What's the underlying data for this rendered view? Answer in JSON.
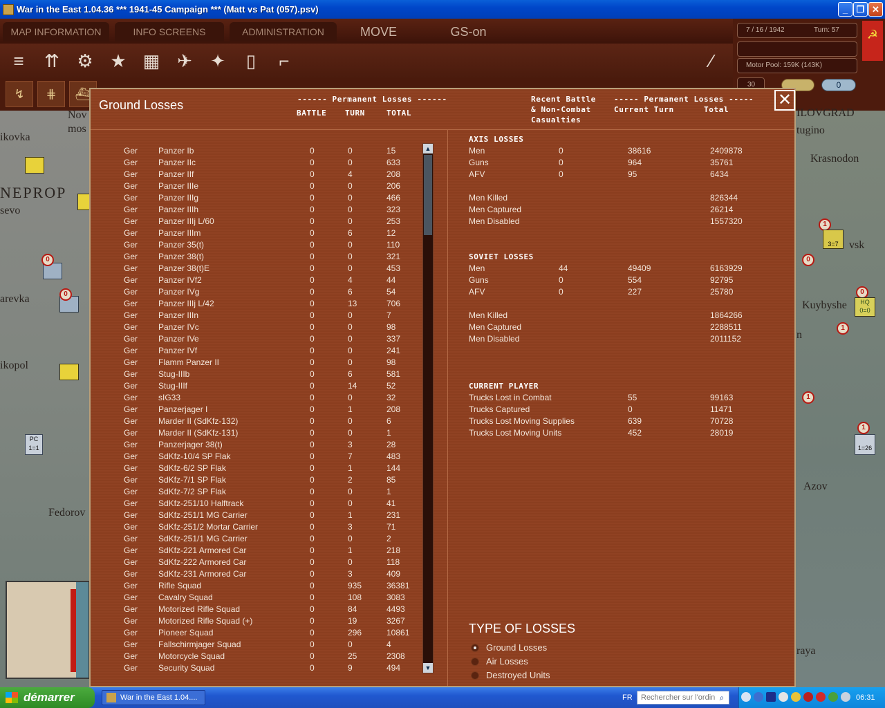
{
  "window": {
    "title": "War in the East 1.04.36        ***   1941-45 Campaign   ***   (Matt vs Pat (057).psv)",
    "minimize": "_",
    "maximize": "❐",
    "close": "✕"
  },
  "menu": {
    "tabs": [
      "MAP INFORMATION",
      "INFO SCREENS",
      "ADMINISTRATION"
    ],
    "mode": "MOVE",
    "gs": "GS-on"
  },
  "toolbar": {
    "icons": [
      "stack-icon",
      "units-icon",
      "gear-icon",
      "star-icon",
      "map-icon",
      "air-icon",
      "satellite-icon",
      "fuel-icon",
      "rail-icon"
    ]
  },
  "status": {
    "date": "7 / 16 / 1942",
    "turn_label": "Turn: 57",
    "motor_pool": "Motor Pool: 159K (143K)",
    "small_value": "30",
    "counter_value": "0",
    "flag_symbol": "☭"
  },
  "map": {
    "labels": [
      "Nov",
      "mos",
      "ikovka",
      "NEPROP",
      "sevo",
      "arevka",
      "ikopol",
      "Fedorov",
      "ILOVGRAD",
      "tugino",
      "Krasnodon",
      "vsk",
      "Kuybyshe",
      "n",
      "Azov",
      "raya"
    ],
    "counter_numbers": [
      "0",
      "0",
      "1",
      "0",
      "0",
      "1",
      "1",
      "1",
      "3"
    ],
    "unit_codes": [
      "PC",
      "1=1",
      "HQ",
      "0=0",
      "1=26",
      "3=7"
    ]
  },
  "dialog": {
    "title": "Ground Losses",
    "close_symbol": "✕",
    "left_header": {
      "group": "------ Permanent Losses ------",
      "battle": "BATTLE",
      "turn": "TURN",
      "total": "TOTAL"
    },
    "right_header": {
      "recent_1": "Recent Battle",
      "recent_2": "& Non-Combat",
      "recent_3": "Casualties",
      "group": "----- Permanent Losses -----",
      "current": "Current Turn",
      "total": "Total"
    },
    "units": [
      [
        "Ger",
        "Panzer Ib",
        "0",
        "0",
        "15"
      ],
      [
        "Ger",
        "Panzer IIc",
        "0",
        "0",
        "633"
      ],
      [
        "Ger",
        "Panzer IIf",
        "0",
        "4",
        "208"
      ],
      [
        "Ger",
        "Panzer IIIe",
        "0",
        "0",
        "206"
      ],
      [
        "Ger",
        "Panzer IIIg",
        "0",
        "0",
        "466"
      ],
      [
        "Ger",
        "Panzer IIIh",
        "0",
        "0",
        "323"
      ],
      [
        "Ger",
        "Panzer IIIj L/60",
        "0",
        "0",
        "253"
      ],
      [
        "Ger",
        "Panzer IIIm",
        "0",
        "6",
        "12"
      ],
      [
        "Ger",
        "Panzer 35(t)",
        "0",
        "0",
        "110"
      ],
      [
        "Ger",
        "Panzer 38(t)",
        "0",
        "0",
        "321"
      ],
      [
        "Ger",
        "Panzer 38(t)E",
        "0",
        "0",
        "453"
      ],
      [
        "Ger",
        "Panzer IVf2",
        "0",
        "4",
        "44"
      ],
      [
        "Ger",
        "Panzer IVg",
        "0",
        "6",
        "54"
      ],
      [
        "Ger",
        "Panzer IIIj L/42",
        "0",
        "13",
        "706"
      ],
      [
        "Ger",
        "Panzer IIIn",
        "0",
        "0",
        "7"
      ],
      [
        "Ger",
        "Panzer IVc",
        "0",
        "0",
        "98"
      ],
      [
        "Ger",
        "Panzer IVe",
        "0",
        "0",
        "337"
      ],
      [
        "Ger",
        "Panzer IVf",
        "0",
        "0",
        "241"
      ],
      [
        "Ger",
        "Flamm Panzer II",
        "0",
        "0",
        "98"
      ],
      [
        "Ger",
        "Stug-IIIb",
        "0",
        "6",
        "581"
      ],
      [
        "Ger",
        "Stug-IIIf",
        "0",
        "14",
        "52"
      ],
      [
        "Ger",
        "sIG33",
        "0",
        "0",
        "32"
      ],
      [
        "Ger",
        "Panzerjager I",
        "0",
        "1",
        "208"
      ],
      [
        "Ger",
        "Marder II (SdKfz-132)",
        "0",
        "0",
        "6"
      ],
      [
        "Ger",
        "Marder II (SdKfz-131)",
        "0",
        "0",
        "1"
      ],
      [
        "Ger",
        "Panzerjager 38(t)",
        "0",
        "3",
        "28"
      ],
      [
        "Ger",
        "SdKfz-10/4 SP Flak",
        "0",
        "7",
        "483"
      ],
      [
        "Ger",
        "SdKfz-6/2 SP Flak",
        "0",
        "1",
        "144"
      ],
      [
        "Ger",
        "SdKfz-7/1 SP Flak",
        "0",
        "2",
        "85"
      ],
      [
        "Ger",
        "SdKfz-7/2 SP Flak",
        "0",
        "0",
        "1"
      ],
      [
        "Ger",
        "SdKfz-251/10 Halftrack",
        "0",
        "0",
        "41"
      ],
      [
        "Ger",
        "SdKfz-251/1 MG Carrier",
        "0",
        "1",
        "231"
      ],
      [
        "Ger",
        "SdKfz-251/2 Mortar Carrier",
        "0",
        "3",
        "71"
      ],
      [
        "Ger",
        "SdKfz-251/1 MG Carrier",
        "0",
        "0",
        "2"
      ],
      [
        "Ger",
        "SdKfz-221 Armored Car",
        "0",
        "1",
        "218"
      ],
      [
        "Ger",
        "SdKfz-222 Armored Car",
        "0",
        "0",
        "118"
      ],
      [
        "Ger",
        "SdKfz-231 Armored Car",
        "0",
        "3",
        "409"
      ],
      [
        "Ger",
        "Rifle Squad",
        "0",
        "935",
        "36381"
      ],
      [
        "Ger",
        "Cavalry Squad",
        "0",
        "108",
        "3083"
      ],
      [
        "Ger",
        "Motorized Rifle Squad",
        "0",
        "84",
        "4493"
      ],
      [
        "Ger",
        "Motorized Rifle Squad (+)",
        "0",
        "19",
        "3267"
      ],
      [
        "Ger",
        "Pioneer Squad",
        "0",
        "296",
        "10861"
      ],
      [
        "Ger",
        "Fallschirmjager Squad",
        "0",
        "0",
        "4"
      ],
      [
        "Ger",
        "Motorcycle Squad",
        "0",
        "25",
        "2308"
      ],
      [
        "Ger",
        "Security Squad",
        "0",
        "9",
        "494"
      ]
    ],
    "axis": {
      "title": "AXIS LOSSES",
      "rows": [
        [
          "Men",
          "0",
          "38616",
          "2409878"
        ],
        [
          "Guns",
          "0",
          "964",
          "35761"
        ],
        [
          "AFV",
          "0",
          "95",
          "6434"
        ]
      ],
      "details": [
        [
          "Men Killed",
          "826344"
        ],
        [
          "Men Captured",
          "26214"
        ],
        [
          "Men Disabled",
          "1557320"
        ]
      ]
    },
    "soviet": {
      "title": "SOVIET LOSSES",
      "rows": [
        [
          "Men",
          "44",
          "49409",
          "6163929"
        ],
        [
          "Guns",
          "0",
          "554",
          "92795"
        ],
        [
          "AFV",
          "0",
          "227",
          "25780"
        ]
      ],
      "details": [
        [
          "Men Killed",
          "1864266"
        ],
        [
          "Men Captured",
          "2288511"
        ],
        [
          "Men Disabled",
          "2011152"
        ]
      ]
    },
    "player": {
      "title": "CURRENT PLAYER",
      "rows": [
        [
          "Trucks Lost in Combat",
          "55",
          "99163"
        ],
        [
          "Trucks Captured",
          "0",
          "11471"
        ],
        [
          "Trucks Lost Moving Supplies",
          "639",
          "70728"
        ],
        [
          "Trucks Lost Moving Units",
          "452",
          "28019"
        ]
      ]
    },
    "type_of_losses": {
      "title": "TYPE OF LOSSES",
      "options": [
        "Ground Losses",
        "Air Losses",
        "Destroyed Units"
      ],
      "selected": "Ground Losses"
    },
    "scroll_up": "▲",
    "scroll_down": "▼"
  },
  "taskbar": {
    "start": "démarrer",
    "task": "War in the East 1.04....",
    "lang": "FR",
    "search_placeholder": "Rechercher sur l'ordin",
    "clock": "06:31"
  }
}
